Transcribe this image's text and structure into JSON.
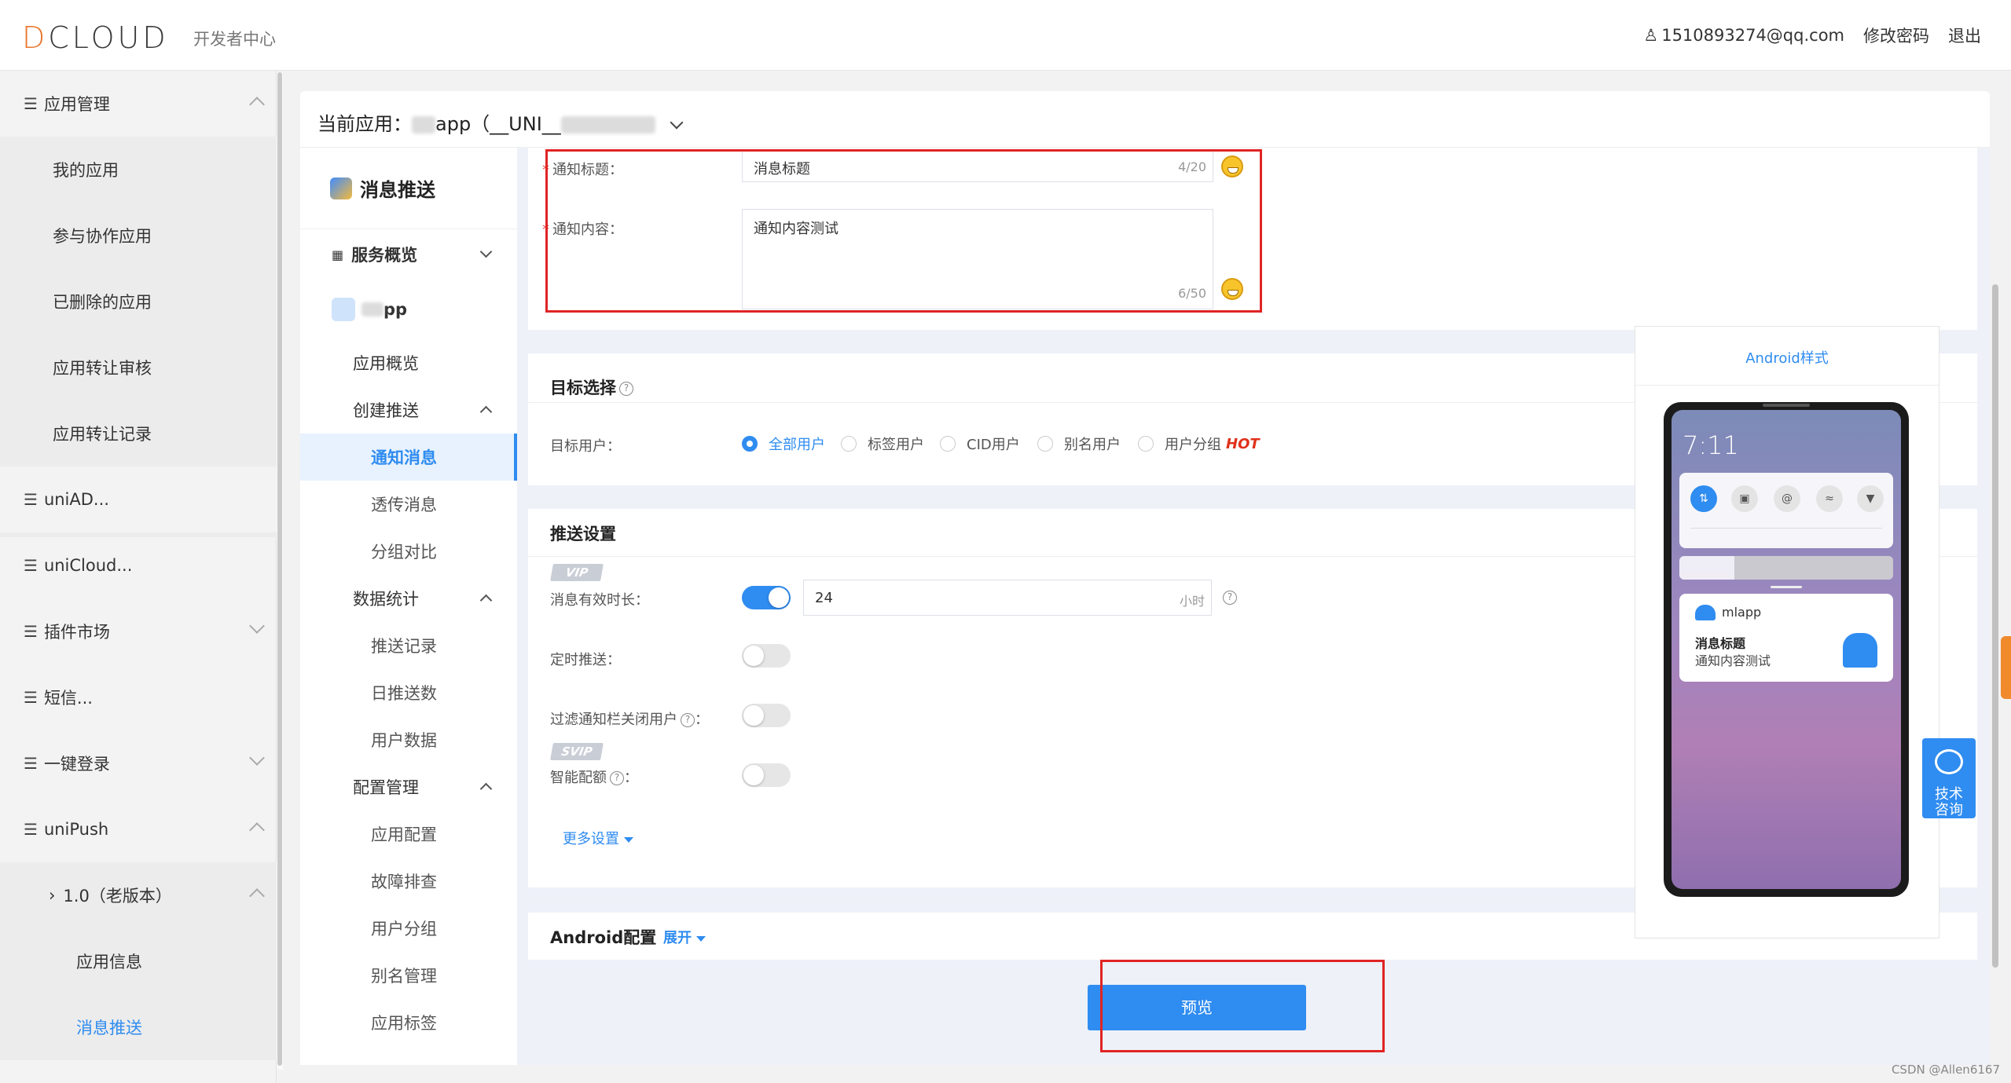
{
  "header": {
    "logo": "DCLOUD",
    "subtitle": "开发者中心",
    "user_email": "1510893274@qq.com",
    "change_password": "修改密码",
    "logout": "退出"
  },
  "sidebar": {
    "app_management": "应用管理",
    "my_apps": "我的应用",
    "collab_apps": "参与协作应用",
    "deleted_apps": "已删除的应用",
    "transfer_review": "应用转让审核",
    "transfer_records": "应用转让记录",
    "uniad": "uniAD...",
    "unicloud": "uniCloud...",
    "plugin_market": "插件市场",
    "sms": "短信...",
    "one_click_login": "一键登录",
    "unipush": "uniPush",
    "old_version": "1.0（老版本）",
    "app_info": "应用信息",
    "message_push": "消息推送"
  },
  "appbar": {
    "label": "当前应用：",
    "app_name_suffix": "app（__UNI__"
  },
  "subnav": {
    "title": "消息推送",
    "service_overview": "服务概览",
    "app_suffix": "pp",
    "app_overview": "应用概览",
    "create_push": "创建推送",
    "notification_msg": "通知消息",
    "transparent_msg": "透传消息",
    "group_compare": "分组对比",
    "data_stats": "数据统计",
    "push_records": "推送记录",
    "daily_push": "日推送数",
    "user_data": "用户数据",
    "config_mgmt": "配置管理",
    "app_config": "应用配置",
    "troubleshoot": "故障排查",
    "user_groups": "用户分组",
    "alias_mgmt": "别名管理",
    "app_tags": "应用标签"
  },
  "form": {
    "title_label": "通知标题：",
    "title_value": "消息标题",
    "title_count": "4/20",
    "content_label": "通知内容：",
    "content_value": "通知内容测试",
    "content_count": "6/50",
    "target_section": "目标选择",
    "target_users_label": "目标用户：",
    "target_options": [
      "全部用户",
      "标签用户",
      "CID用户",
      "别名用户",
      "用户分组"
    ],
    "hot_badge": "HOT",
    "push_settings": "推送设置",
    "vip_badge": "VIP",
    "svip_badge": "SVIP",
    "validity_label": "消息有效时长：",
    "validity_value": "24",
    "validity_unit": "小时",
    "scheduled_label": "定时推送：",
    "filter_label": "过滤通知栏关闭用户",
    "smart_quota_label": "智能配额",
    "more_settings": "更多设置",
    "android_config": "Android配置",
    "expand": "展开",
    "preview_button": "预览"
  },
  "preview": {
    "title": "Android样式",
    "time": "7:11",
    "app_name": "mlapp",
    "notif_title": "消息标题",
    "notif_body": "通知内容测试"
  },
  "help": {
    "label": "技术咨询"
  },
  "watermark": "CSDN @Allen6167",
  "colors": {
    "accent": "#2f8cf0",
    "highlight_box": "#e02424",
    "brand_orange": "#e8772e"
  }
}
